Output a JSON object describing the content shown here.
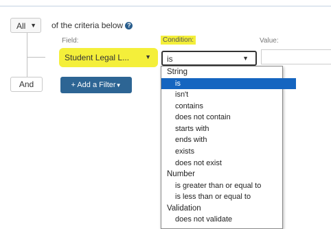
{
  "match_selector": {
    "value": "All"
  },
  "criteria_text": "of the criteria below",
  "labels": {
    "field": "Field:",
    "condition": "Condition:",
    "value": "Value:"
  },
  "field_select": {
    "value": "Student Legal L..."
  },
  "condition_select": {
    "value": "is"
  },
  "value_input": {
    "value": ""
  },
  "and_label": "And",
  "add_filter_button": {
    "label": "+ Add a Filter"
  },
  "condition_menu": {
    "groups": [
      {
        "label": "String",
        "options": [
          "is",
          "isn't",
          "contains",
          "does not contain",
          "starts with",
          "ends with",
          "exists",
          "does not exist"
        ]
      },
      {
        "label": "Number",
        "options": [
          "is greater than or equal to",
          "is less than or equal to"
        ]
      },
      {
        "label": "Validation",
        "options": [
          "does not validate"
        ]
      }
    ],
    "selected": "is"
  },
  "colors": {
    "highlight": "#f4ef3a",
    "button": "#2d6594",
    "selected_option": "#1565c0"
  }
}
